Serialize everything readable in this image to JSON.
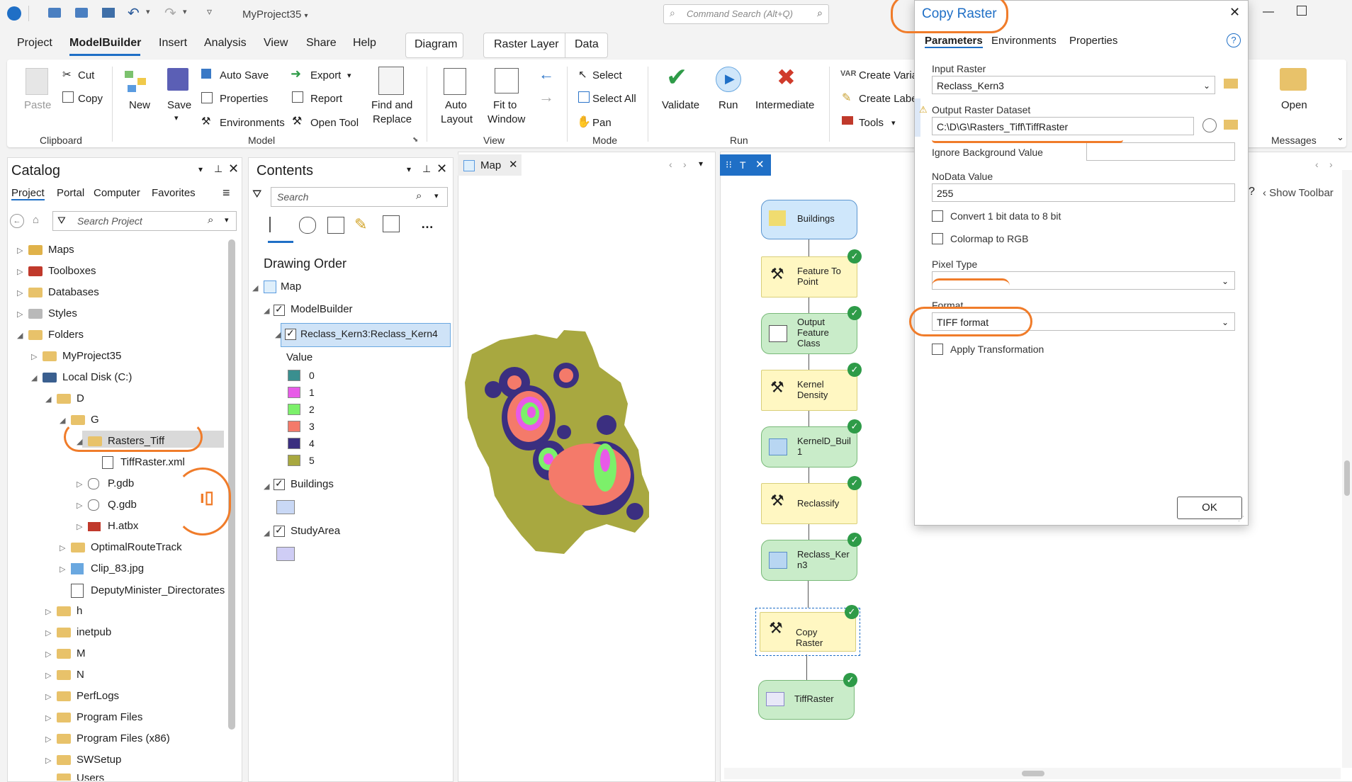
{
  "titlebar": {
    "project_name": "MyProject35",
    "command_search_placeholder": "Command Search (Alt+Q)"
  },
  "menubar": {
    "items": [
      "Project",
      "ModelBuilder",
      "Insert",
      "Analysis",
      "View",
      "Share",
      "Help"
    ],
    "contextual_tabs": [
      "Diagram",
      "Raster Layer",
      "Data"
    ]
  },
  "ribbon": {
    "clipboard": {
      "paste": "Paste",
      "cut": "Cut",
      "copy": "Copy",
      "group": "Clipboard"
    },
    "model": {
      "new": "New",
      "save": "Save",
      "auto_save": "Auto Save",
      "properties": "Properties",
      "environments": "Environments",
      "export": "Export",
      "report": "Report",
      "open_tool": "Open Tool",
      "find_replace_1": "Find and",
      "find_replace_2": "Replace",
      "group": "Model"
    },
    "view": {
      "auto_layout_1": "Auto",
      "auto_layout_2": "Layout",
      "fit_1": "Fit to",
      "fit_2": "Window",
      "group": "View"
    },
    "mode": {
      "select": "Select",
      "select_all": "Select All",
      "pan": "Pan",
      "group": "Mode"
    },
    "run": {
      "validate": "Validate",
      "run": "Run",
      "intermediate": "Intermediate",
      "group": "Run"
    },
    "insert": {
      "create_variable": "Create Varia",
      "create_label": "Create Labe",
      "tools": "Tools"
    },
    "messages": {
      "open": "Open",
      "group": "Messages"
    }
  },
  "catalog": {
    "title": "Catalog",
    "tabs": [
      "Project",
      "Portal",
      "Computer",
      "Favorites"
    ],
    "search_placeholder": "Search Project",
    "items": [
      {
        "label": "Maps"
      },
      {
        "label": "Toolboxes"
      },
      {
        "label": "Databases"
      },
      {
        "label": "Styles"
      },
      {
        "label": "Folders"
      },
      {
        "label": "MyProject35"
      },
      {
        "label": "Local Disk (C:)"
      },
      {
        "label": "D"
      },
      {
        "label": "G"
      },
      {
        "label": "Rasters_Tiff"
      },
      {
        "label": "TiffRaster.xml"
      },
      {
        "label": "P.gdb"
      },
      {
        "label": "Q.gdb"
      },
      {
        "label": "H.atbx"
      },
      {
        "label": "OptimalRouteTrack"
      },
      {
        "label": "Clip_83.jpg"
      },
      {
        "label": "DeputyMinister_Directorates"
      },
      {
        "label": "h"
      },
      {
        "label": "inetpub"
      },
      {
        "label": "M"
      },
      {
        "label": "N"
      },
      {
        "label": "PerfLogs"
      },
      {
        "label": "Program Files"
      },
      {
        "label": "Program Files (x86)"
      },
      {
        "label": "SWSetup"
      },
      {
        "label": "Users"
      }
    ]
  },
  "contents": {
    "title": "Contents",
    "search_placeholder": "Search",
    "drawing_order": "Drawing Order",
    "map": "Map",
    "modelbuilder": "ModelBuilder",
    "raster_layer": "Reclass_Kern3:Reclass_Kern4",
    "value_header": "Value",
    "legend": [
      {
        "label": "0",
        "color": "#3a8f8f"
      },
      {
        "label": "1",
        "color": "#e85ae8"
      },
      {
        "label": "2",
        "color": "#7cf06a"
      },
      {
        "label": "3",
        "color": "#f47a6a"
      },
      {
        "label": "4",
        "color": "#3b2f80"
      },
      {
        "label": "5",
        "color": "#a8a840"
      }
    ],
    "buildings": "Buildings",
    "buildings_color": "#c9d8f5",
    "studyarea": "StudyArea",
    "studyarea_color": "#cfcdf5"
  },
  "map_tab": {
    "label": "Map"
  },
  "model_tab": {
    "label": "T"
  },
  "model": {
    "show_toolbar": "Show Toolbar",
    "nodes": [
      {
        "label": "Buildings"
      },
      {
        "label": "Feature To Point"
      },
      {
        "label": "Output Feature Class"
      },
      {
        "label": "Kernel Density"
      },
      {
        "label": "KernelD_Buil 1"
      },
      {
        "label": "Reclassify"
      },
      {
        "label": "Reclass_Ker n3"
      },
      {
        "label": "Copy Raster"
      },
      {
        "label": "TiffRaster"
      }
    ]
  },
  "dialog": {
    "title": "Copy Raster",
    "tabs": [
      "Parameters",
      "Environments",
      "Properties"
    ],
    "input_raster_label": "Input Raster",
    "input_raster_value": "Reclass_Kern3",
    "output_label": "Output Raster Dataset",
    "output_value": "C:\\D\\G\\Rasters_Tiff\\TiffRaster",
    "ignore_bg_label": "Ignore Background Value",
    "nodata_label": "NoData Value",
    "nodata_value": "255",
    "convert_label": "Convert 1 bit data to 8 bit",
    "colormap_label": "Colormap to RGB",
    "pixel_type_label": "Pixel Type",
    "format_label": "Format",
    "format_value": "TIFF format",
    "apply_label": "Apply Transformation",
    "ok": "OK"
  }
}
